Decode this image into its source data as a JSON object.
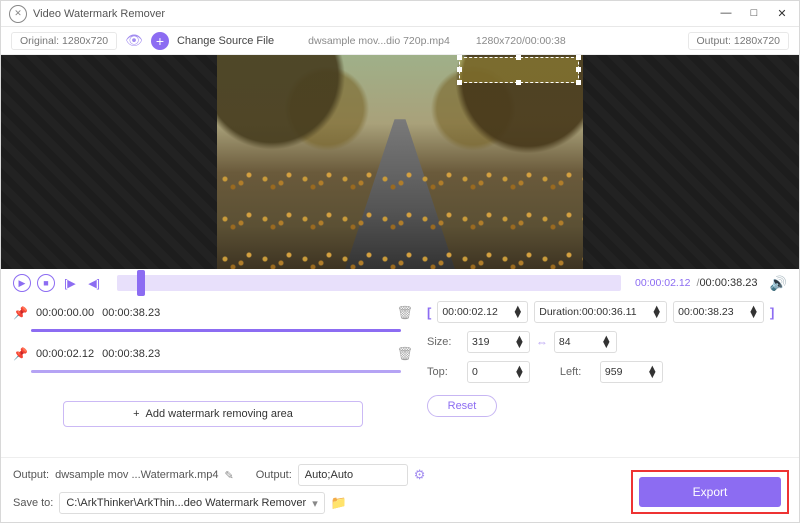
{
  "window": {
    "title": "Video Watermark Remover"
  },
  "info": {
    "original_label": "Original: 1280x720",
    "change_source": "Change Source File",
    "filename": "dwsample mov...dio 720p.mp4",
    "dims_time": "1280x720/00:00:38",
    "output_label": "Output: 1280x720"
  },
  "playback": {
    "current": "00:00:02.12",
    "total": "00:00:38.23"
  },
  "segments": [
    {
      "start": "00:00:00.00",
      "end": "00:00:38.23"
    },
    {
      "start": "00:00:02.12",
      "end": "00:00:38.23"
    }
  ],
  "add_area_label": "Add watermark removing area",
  "range": {
    "start": "00:00:02.12",
    "duration_label": "Duration:00:00:36.11",
    "end": "00:00:38.23"
  },
  "size": {
    "label": "Size:",
    "w": "319",
    "h": "84"
  },
  "pos": {
    "top_label": "Top:",
    "top": "0",
    "left_label": "Left:",
    "left": "959"
  },
  "reset": "Reset",
  "output": {
    "label1": "Output:",
    "filename": "dwsample mov ...Watermark.mp4",
    "label2": "Output:",
    "format": "Auto;Auto"
  },
  "save": {
    "label": "Save to:",
    "path": "C:\\ArkThinker\\ArkThin...deo Watermark Remover"
  },
  "export": "Export"
}
